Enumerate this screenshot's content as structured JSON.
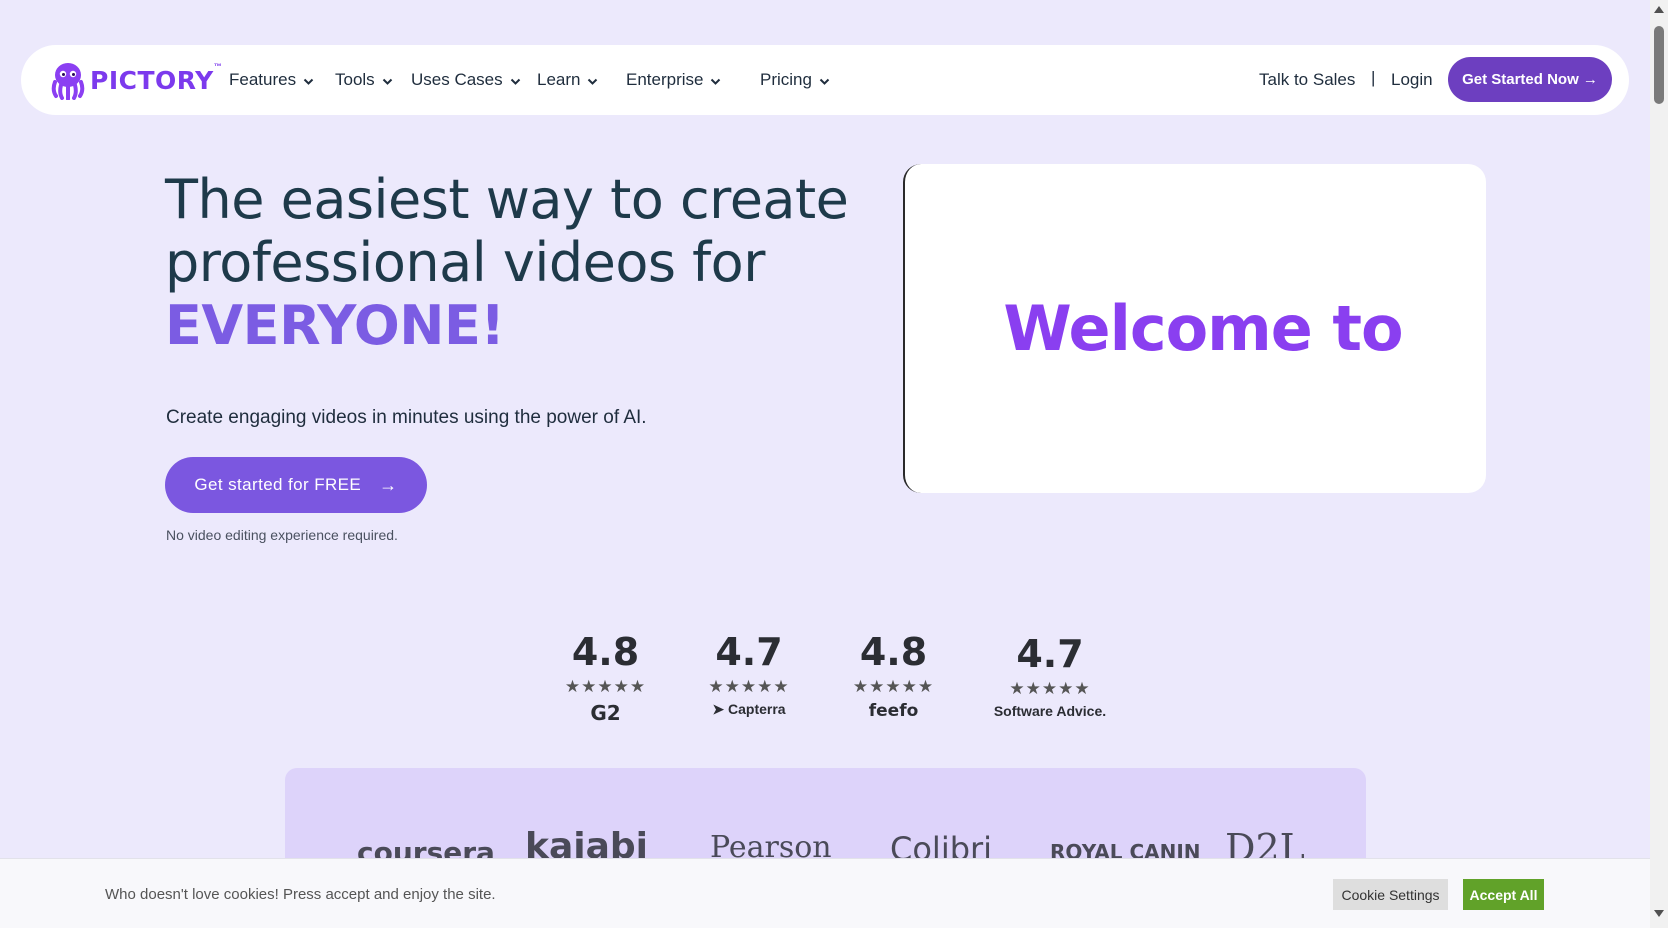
{
  "nav": {
    "brand": "PICTORY",
    "brand_tm": "™",
    "menu": [
      {
        "label": "Features"
      },
      {
        "label": "Tools"
      },
      {
        "label": "Uses Cases"
      },
      {
        "label": "Learn"
      },
      {
        "label": "Enterprise"
      },
      {
        "label": "Pricing"
      }
    ],
    "talk_to_sales": "Talk to Sales",
    "separator": "|",
    "login": "Login",
    "get_started": "Get Started Now →"
  },
  "hero": {
    "title_line1": "The easiest way to create",
    "title_line2": "professional videos for",
    "title_accent": "EVERYONE!",
    "subtitle": "Create engaging videos in minutes using the power of AI.",
    "cta_label": "Get started for FREE",
    "cta_arrow": "→",
    "note": "No video editing experience required."
  },
  "video": {
    "text": "Welcome to"
  },
  "ratings": [
    {
      "value": "4.8",
      "stars": "★★★★★",
      "brand": "G2"
    },
    {
      "value": "4.7",
      "stars": "★★★★★",
      "brand": "Capterra"
    },
    {
      "value": "4.8",
      "stars": "★★★★★",
      "brand": "feefo"
    },
    {
      "value": "4.7",
      "stars": "★★★★★",
      "brand": "Software Advice."
    }
  ],
  "clients": [
    "coursera",
    "kajabi",
    "Pearson",
    "Colibri",
    "ROYAL CANIN",
    "D2L"
  ],
  "cookie": {
    "text": "Who doesn't love cookies! Press accept and enjoy the site.",
    "settings": "Cookie Settings",
    "accept": "Accept All"
  },
  "colors": {
    "accent": "#7b57e0",
    "brand": "#7c3aed",
    "page_bg": "#ece9fc",
    "accept_green": "#61a229"
  }
}
